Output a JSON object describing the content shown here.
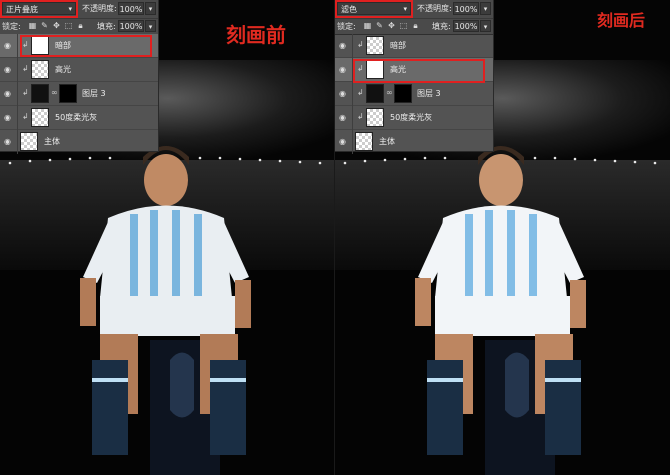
{
  "left": {
    "blend_mode": "正片叠底",
    "title_label": "刻画前",
    "selected_layer": "暗部"
  },
  "right": {
    "blend_mode": "滤色",
    "title_label": "刻画后",
    "selected_layer": "高光"
  },
  "panel": {
    "opacity_label": "不透明度:",
    "opacity_value": "100%",
    "lock_label": "锁定:",
    "fill_label": "填充:",
    "fill_value": "100%",
    "layers": [
      "暗部",
      "高光",
      "图层 3",
      "50度柔光灰",
      "主体"
    ]
  },
  "colors": {
    "annotation": "#e02a20",
    "panel_bg": "#535353"
  },
  "icons": [
    "eye-icon",
    "clip-arrow-icon",
    "link-icon",
    "lock-icon",
    "dropdown-arrow-icon"
  ]
}
